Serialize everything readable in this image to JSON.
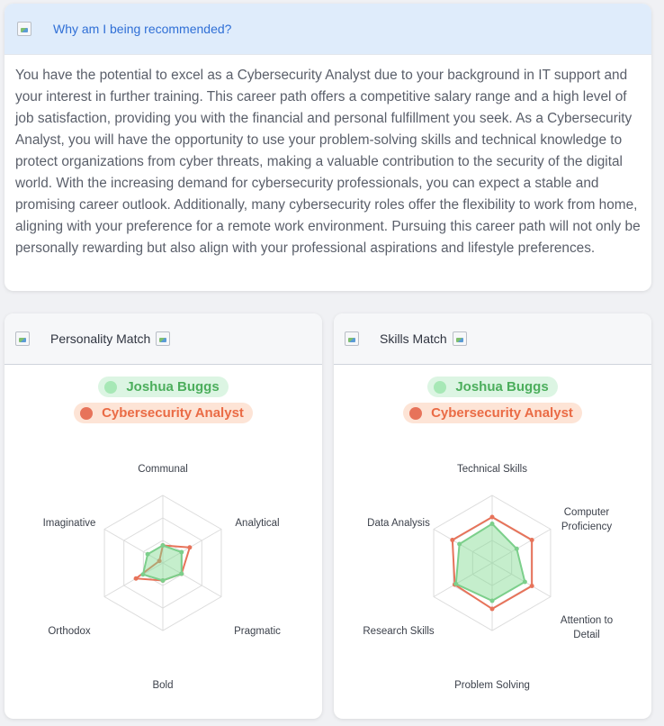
{
  "why": {
    "title": "Why am I being recommended?",
    "body": "You have the potential to excel as a Cybersecurity Analyst due to your background in IT support and your interest in further training. This career path offers a competitive salary range and a high level of job satisfaction, providing you with the financial and personal fulfillment you seek. As a Cybersecurity Analyst, you will have the opportunity to use your problem-solving skills and technical knowledge to protect organizations from cyber threats, making a valuable contribution to the security of the digital world. With the increasing demand for cybersecurity professionals, you can expect a stable and promising career outlook. Additionally, many cybersecurity roles offer the flexibility to work from home, aligning with your preference for a remote work environment. Pursuing this career path will not only be personally rewarding but also align with your professional aspirations and lifestyle preferences."
  },
  "personality": {
    "title": "Personality Match",
    "legend": {
      "user": "Joshua Buggs",
      "career": "Cybersecurity Analyst"
    }
  },
  "skills": {
    "title": "Skills Match",
    "legend": {
      "user": "Joshua Buggs",
      "career": "Cybersecurity Analyst"
    }
  },
  "colors": {
    "user_series": "#7fd98f",
    "career_series": "#e7735a",
    "accent_link": "#2f6fd6"
  },
  "chart_data": [
    {
      "type": "radar",
      "axes": [
        "Communal",
        "Analytical",
        "Pragmatic",
        "Bold",
        "Orthodox",
        "Imaginative"
      ],
      "range": [
        0,
        5
      ],
      "series": [
        {
          "name": "Joshua Buggs",
          "values": [
            1.3,
            1.6,
            1.6,
            1.3,
            1.7,
            1.3
          ]
        },
        {
          "name": "Cybersecurity Analyst",
          "values": [
            1.3,
            2.3,
            1.6,
            1.3,
            2.3,
            0.3
          ]
        }
      ]
    },
    {
      "type": "radar",
      "axes": [
        "Technical Skills",
        "Computer Proficiency",
        "Attention to Detail",
        "Problem Solving",
        "Research Skills",
        "Data Analysis"
      ],
      "range": [
        0,
        5
      ],
      "series": [
        {
          "name": "Joshua Buggs",
          "values": [
            2.9,
            2.1,
            2.8,
            2.8,
            3.1,
            2.8
          ]
        },
        {
          "name": "Cybersecurity Analyst",
          "values": [
            3.4,
            3.4,
            3.4,
            3.4,
            3.2,
            3.4
          ]
        }
      ]
    }
  ]
}
